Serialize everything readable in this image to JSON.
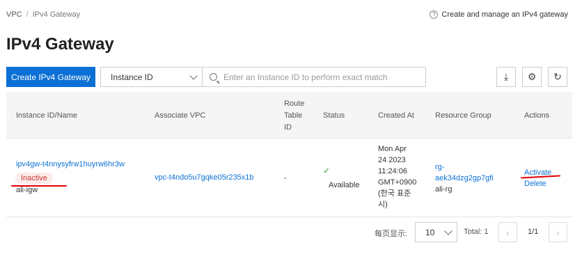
{
  "breadcrumb": {
    "root": "VPC",
    "sep": "/",
    "current": "IPv4 Gateway"
  },
  "help": {
    "icon": "?",
    "text": "Create and manage an IPv4 gateway"
  },
  "page_title": "IPv4 Gateway",
  "toolbar": {
    "create_label": "Create IPv4 Gateway",
    "filter_select": "Instance ID",
    "search_placeholder": "Enter an Instance ID to perform exact match",
    "download_icon": "⤓",
    "settings_icon": "⚙",
    "refresh_icon": "↻"
  },
  "table": {
    "headers": {
      "instance": "Instance ID/Name",
      "vpc": "Associate VPC",
      "route_line1": "Route",
      "route_line2": "Table",
      "route_line3": "ID",
      "status": "Status",
      "created": "Created At",
      "rg": "Resource Group",
      "actions": "Actions"
    },
    "rows": [
      {
        "instance_id": "ipv4gw-t4nnysyfrw1huyrw6hr3w",
        "state_badge": "Inactive",
        "name": "ali-igw",
        "vpc": "vpc-t4ndo5u7gqke05r235x1b",
        "route_table": "-",
        "status_icon": "✓",
        "status": "Available",
        "created_lines": [
          "Mon Apr",
          "24 2023",
          "11:24:06",
          "GMT+0900",
          "(한국 표준",
          "시)"
        ],
        "rg_line1": "rg-",
        "rg_line2": "aek34dzg2gp7gfi",
        "rg_name": "ali-rg",
        "action_activate": "Activate",
        "action_delete": "Delete"
      }
    ]
  },
  "pagination": {
    "page_size_label": "每页显示:",
    "page_size": "10",
    "total": "Total: 1",
    "prev_icon": "‹",
    "next_icon": "›",
    "page_info": "1/1"
  },
  "colors": {
    "primary": "#0b70d5",
    "annotation": "#e00000",
    "inactive_bg": "#fbeceb"
  }
}
